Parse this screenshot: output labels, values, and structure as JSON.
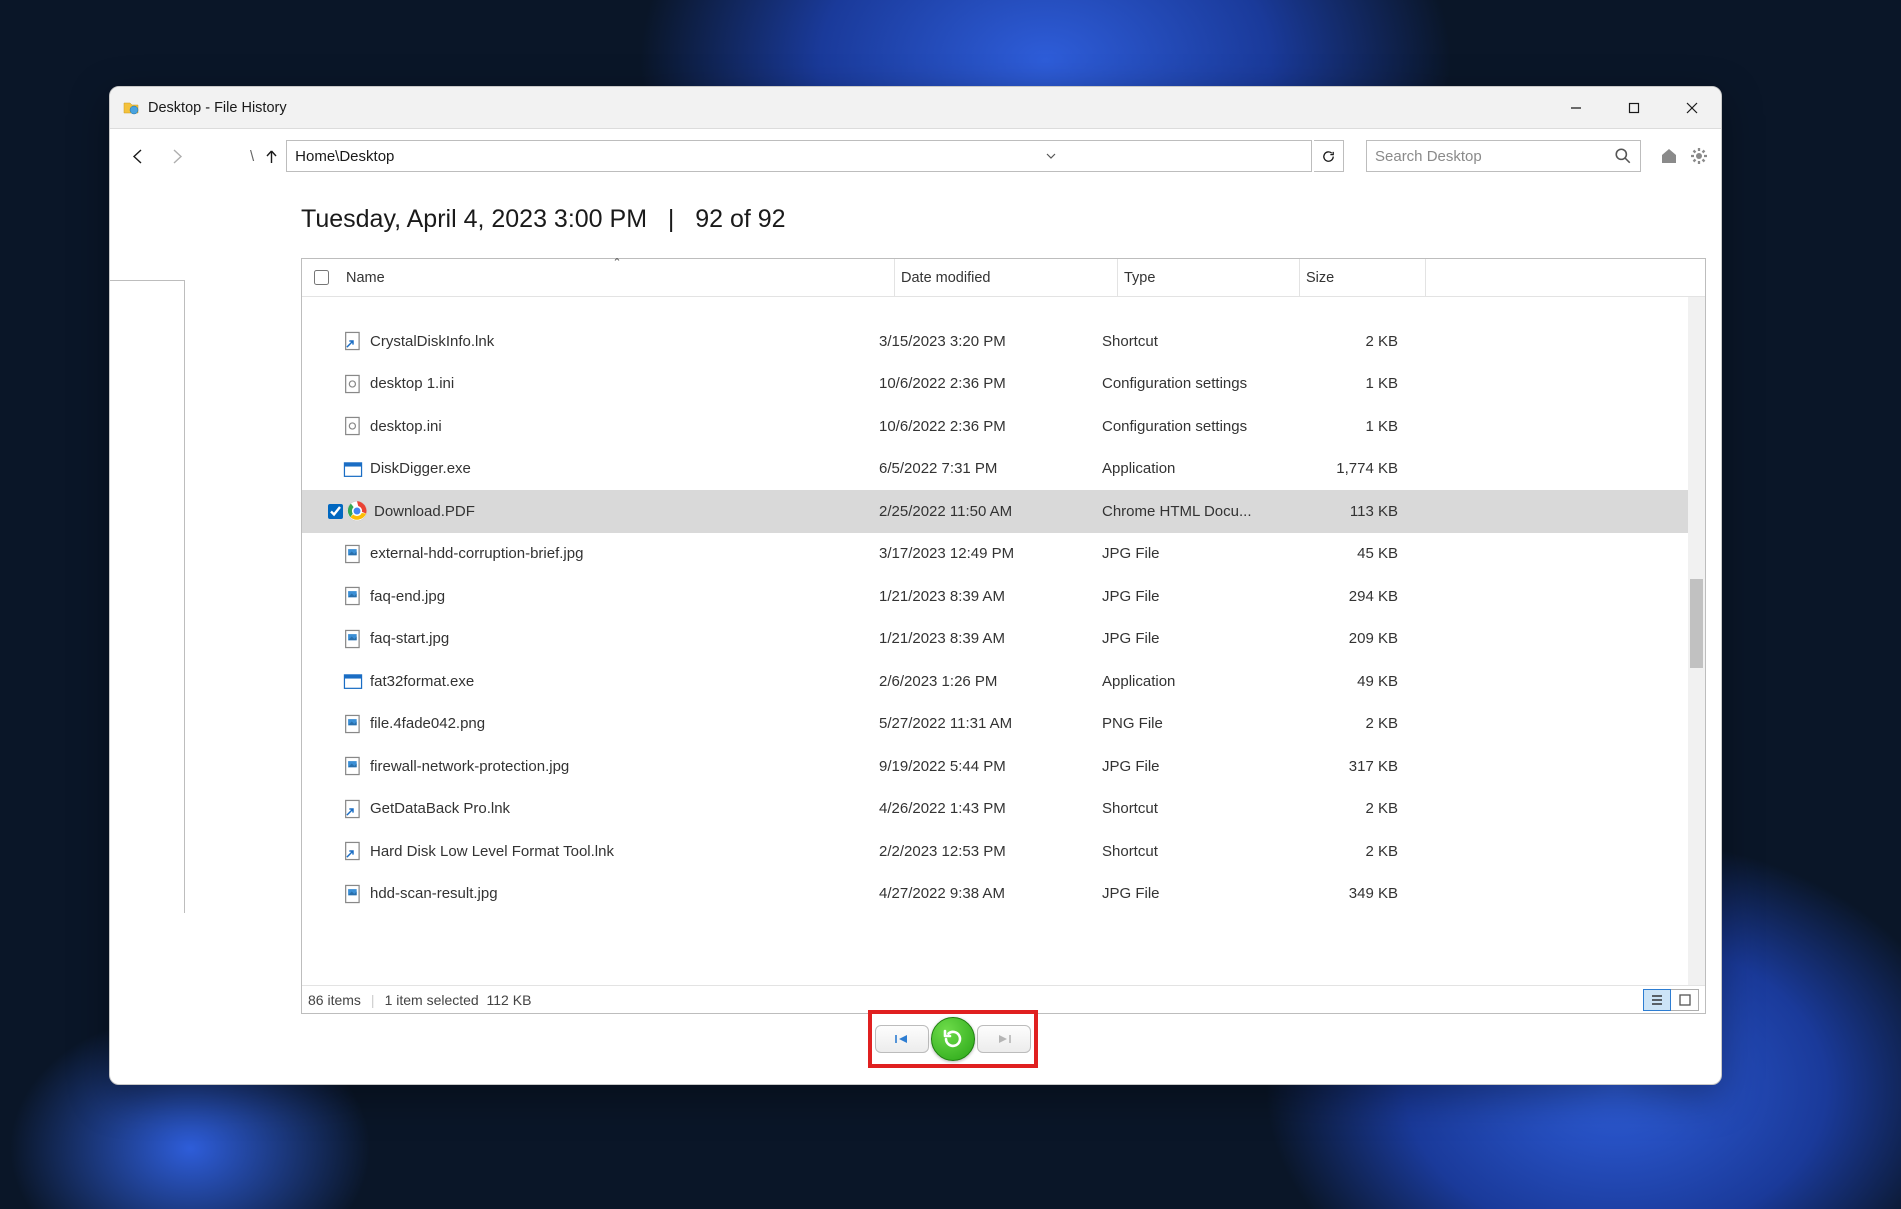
{
  "window": {
    "title": "Desktop - File History"
  },
  "path": {
    "text": "Home\\Desktop"
  },
  "search": {
    "placeholder": "Search Desktop"
  },
  "heading": {
    "timestamp": "Tuesday, April 4, 2023 3:00 PM",
    "separator": "|",
    "pager": "92 of 92"
  },
  "columns": {
    "name": "Name",
    "date": "Date modified",
    "type": "Type",
    "size": "Size"
  },
  "partial_row": {
    "name": "",
    "date": "",
    "type": ".",
    "size": ""
  },
  "files": [
    {
      "icon": "shortcut",
      "name": "CrystalDiskInfo.lnk",
      "date": "3/15/2023 3:20 PM",
      "type": "Shortcut",
      "size": "2 KB",
      "selected": false
    },
    {
      "icon": "ini",
      "name": "desktop 1.ini",
      "date": "10/6/2022 2:36 PM",
      "type": "Configuration settings",
      "size": "1 KB",
      "selected": false
    },
    {
      "icon": "ini",
      "name": "desktop.ini",
      "date": "10/6/2022 2:36 PM",
      "type": "Configuration settings",
      "size": "1 KB",
      "selected": false
    },
    {
      "icon": "exe",
      "name": "DiskDigger.exe",
      "date": "6/5/2022 7:31 PM",
      "type": "Application",
      "size": "1,774 KB",
      "selected": false
    },
    {
      "icon": "chrome",
      "name": "Download.PDF",
      "date": "2/25/2022 11:50 AM",
      "type": "Chrome HTML Docu...",
      "size": "113 KB",
      "selected": true
    },
    {
      "icon": "jpg",
      "name": "external-hdd-corruption-brief.jpg",
      "date": "3/17/2023 12:49 PM",
      "type": "JPG File",
      "size": "45 KB",
      "selected": false
    },
    {
      "icon": "jpg",
      "name": "faq-end.jpg",
      "date": "1/21/2023 8:39 AM",
      "type": "JPG File",
      "size": "294 KB",
      "selected": false
    },
    {
      "icon": "jpg",
      "name": "faq-start.jpg",
      "date": "1/21/2023 8:39 AM",
      "type": "JPG File",
      "size": "209 KB",
      "selected": false
    },
    {
      "icon": "exe",
      "name": "fat32format.exe",
      "date": "2/6/2023 1:26 PM",
      "type": "Application",
      "size": "49 KB",
      "selected": false
    },
    {
      "icon": "png",
      "name": "file.4fade042.png",
      "date": "5/27/2022 11:31 AM",
      "type": "PNG File",
      "size": "2 KB",
      "selected": false
    },
    {
      "icon": "jpg",
      "name": "firewall-network-protection.jpg",
      "date": "9/19/2022 5:44 PM",
      "type": "JPG File",
      "size": "317 KB",
      "selected": false
    },
    {
      "icon": "shortcut",
      "name": "GetDataBack Pro.lnk",
      "date": "4/26/2022 1:43 PM",
      "type": "Shortcut",
      "size": "2 KB",
      "selected": false
    },
    {
      "icon": "shortcut",
      "name": "Hard Disk Low Level Format Tool.lnk",
      "date": "2/2/2023 12:53 PM",
      "type": "Shortcut",
      "size": "2 KB",
      "selected": false
    },
    {
      "icon": "jpg",
      "name": "hdd-scan-result.jpg",
      "date": "4/27/2022 9:38 AM",
      "type": "JPG File",
      "size": "349 KB",
      "selected": false
    }
  ],
  "status": {
    "items": "86 items",
    "selected": "1 item selected",
    "size": "112 KB"
  }
}
